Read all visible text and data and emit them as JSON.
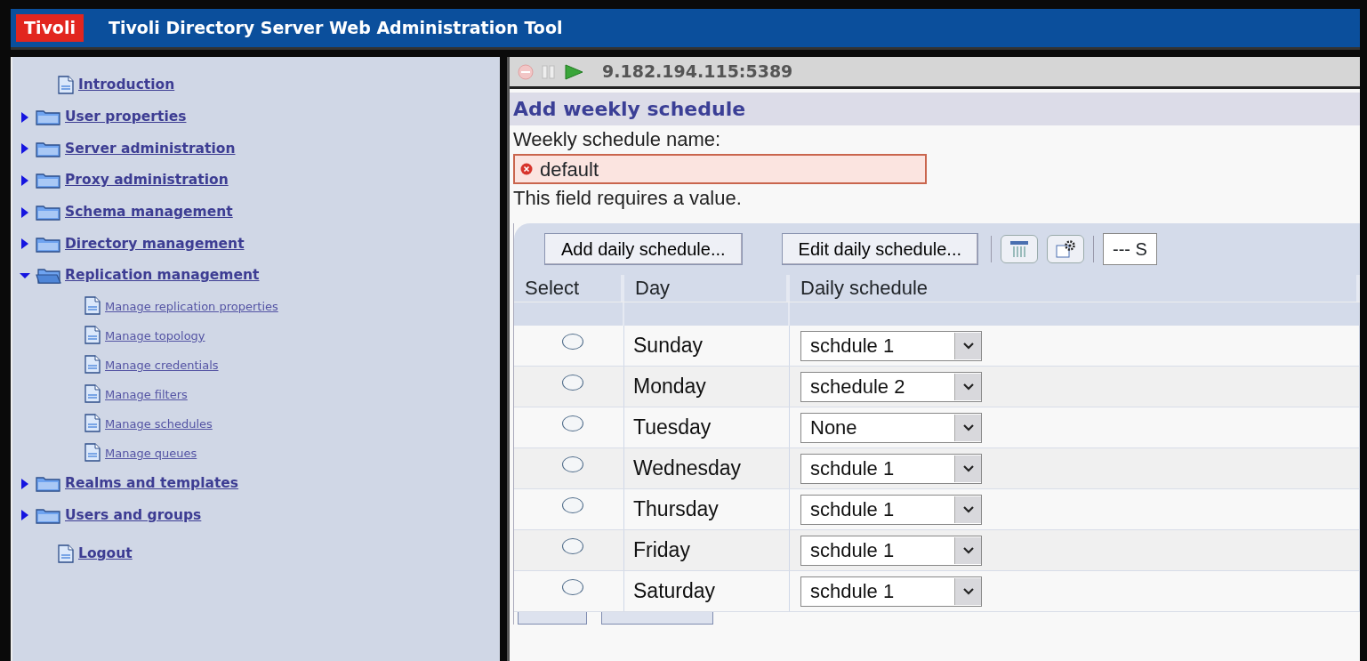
{
  "app": {
    "logo": "Tivoli",
    "title": "Tivoli Directory Server Web Administration Tool"
  },
  "sidebar": {
    "items": [
      {
        "label": "Introduction",
        "kind": "page"
      },
      {
        "label": "User properties",
        "kind": "folder",
        "expanded": false
      },
      {
        "label": "Server administration",
        "kind": "folder",
        "expanded": false
      },
      {
        "label": "Proxy administration",
        "kind": "folder",
        "expanded": false
      },
      {
        "label": "Schema management",
        "kind": "folder",
        "expanded": false
      },
      {
        "label": "Directory management",
        "kind": "folder",
        "expanded": false
      },
      {
        "label": "Replication management",
        "kind": "folder",
        "expanded": true,
        "children": [
          {
            "label": "Manage replication properties",
            "kind": "page"
          },
          {
            "label": "Manage topology",
            "kind": "page"
          },
          {
            "label": "Manage credentials",
            "kind": "page"
          },
          {
            "label": "Manage filters",
            "kind": "page"
          },
          {
            "label": "Manage schedules",
            "kind": "page"
          },
          {
            "label": "Manage queues",
            "kind": "page"
          }
        ]
      },
      {
        "label": "Realms and templates",
        "kind": "folder",
        "expanded": false
      },
      {
        "label": "Users and groups",
        "kind": "folder",
        "expanded": false
      },
      {
        "label": "Logout",
        "kind": "page"
      }
    ]
  },
  "connection": {
    "address": "9.182.194.115:5389"
  },
  "form": {
    "title": "Add weekly schedule",
    "field_label": "Weekly schedule name:",
    "field_value": "default",
    "invalid": true,
    "error": "This field requires a value."
  },
  "toolbar": {
    "buttons": [
      "Add daily schedule...",
      "Edit daily schedule..."
    ],
    "select_text": "--- S"
  },
  "table": {
    "columns": [
      "Select",
      "Day",
      "Daily schedule"
    ],
    "rows": [
      {
        "selected": false,
        "day": "Sunday",
        "schedule": "schdule 1"
      },
      {
        "selected": false,
        "day": "Monday",
        "schedule": "schedule 2"
      },
      {
        "selected": false,
        "day": "Tuesday",
        "schedule": "None"
      },
      {
        "selected": false,
        "day": "Wednesday",
        "schedule": "schdule 1"
      },
      {
        "selected": false,
        "day": "Thursday",
        "schedule": "schdule 1"
      },
      {
        "selected": false,
        "day": "Friday",
        "schedule": "schdule 1"
      },
      {
        "selected": false,
        "day": "Saturday",
        "schedule": "schdule 1"
      }
    ]
  }
}
